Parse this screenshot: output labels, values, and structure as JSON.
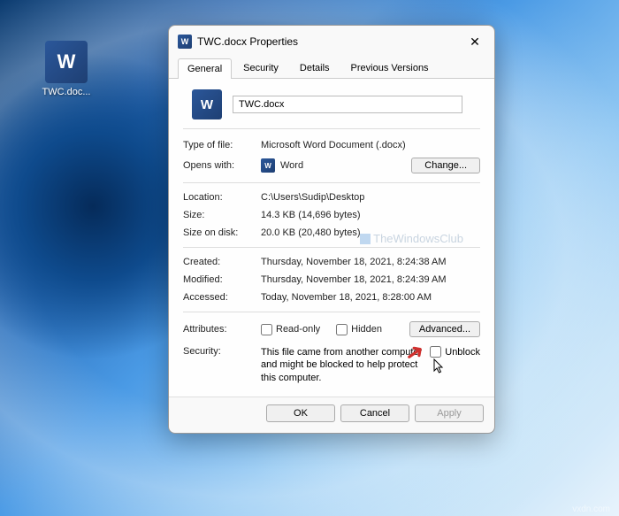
{
  "desktop": {
    "file_label": "TWC.doc..."
  },
  "dialog": {
    "title": "TWC.docx Properties",
    "tabs": {
      "general": "General",
      "security": "Security",
      "details": "Details",
      "previous": "Previous Versions"
    },
    "filename": "TWC.docx",
    "rows": {
      "type_label": "Type of file:",
      "type_value": "Microsoft Word Document (.docx)",
      "opens_label": "Opens with:",
      "opens_value": "Word",
      "change_btn": "Change...",
      "location_label": "Location:",
      "location_value": "C:\\Users\\Sudip\\Desktop",
      "size_label": "Size:",
      "size_value": "14.3 KB (14,696 bytes)",
      "disk_label": "Size on disk:",
      "disk_value": "20.0 KB (20,480 bytes)",
      "created_label": "Created:",
      "created_value": "Thursday, November 18, 2021, 8:24:38 AM",
      "modified_label": "Modified:",
      "modified_value": "Thursday, November 18, 2021, 8:24:39 AM",
      "accessed_label": "Accessed:",
      "accessed_value": "Today, November 18, 2021, 8:28:00 AM",
      "attributes_label": "Attributes:",
      "readonly_label": "Read-only",
      "hidden_label": "Hidden",
      "advanced_btn": "Advanced...",
      "security_label": "Security:",
      "security_text": "This file came from another computer and might be blocked to help protect this computer.",
      "unblock_label": "Unblock"
    },
    "footer": {
      "ok": "OK",
      "cancel": "Cancel",
      "apply": "Apply"
    }
  },
  "watermark": "TheWindowsClub",
  "source": "vxdn.com"
}
